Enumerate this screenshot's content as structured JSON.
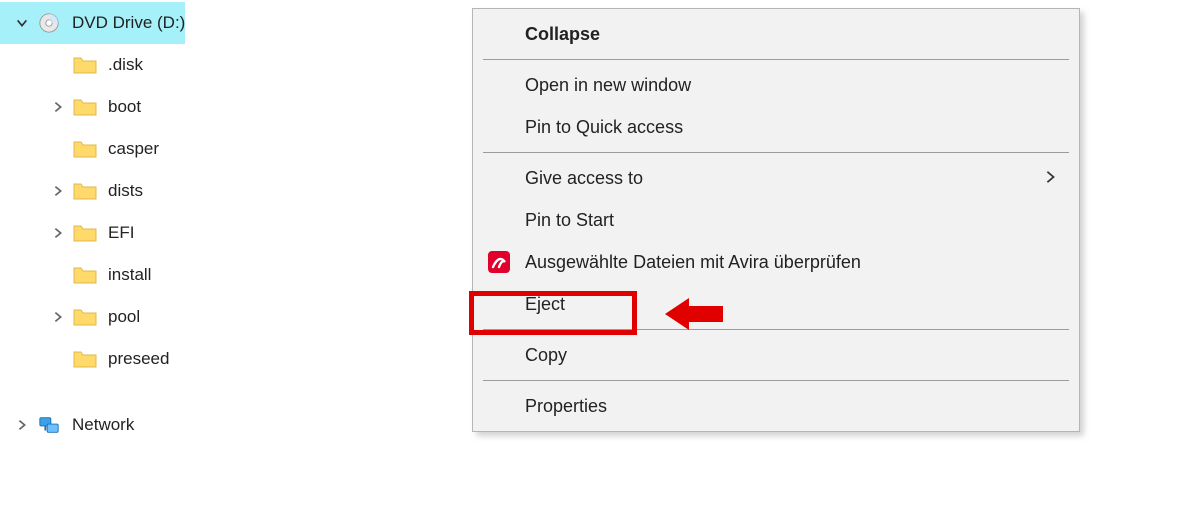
{
  "tree": {
    "drive": {
      "label": "DVD Drive (D:)",
      "expanded": true
    },
    "children": [
      {
        "label": ".disk",
        "expandable": false
      },
      {
        "label": "boot",
        "expandable": true
      },
      {
        "label": "casper",
        "expandable": false
      },
      {
        "label": "dists",
        "expandable": true
      },
      {
        "label": "EFI",
        "expandable": true
      },
      {
        "label": "install",
        "expandable": false
      },
      {
        "label": "pool",
        "expandable": true
      },
      {
        "label": "preseed",
        "expandable": false
      }
    ],
    "network": {
      "label": "Network",
      "expandable": true
    }
  },
  "menu": {
    "collapse": "Collapse",
    "open_new": "Open in new window",
    "pin_quick": "Pin to Quick access",
    "give_access": "Give access to",
    "pin_start": "Pin to Start",
    "avira": "Ausgewählte Dateien mit Avira überprüfen",
    "eject": "Eject",
    "copy": "Copy",
    "properties": "Properties"
  },
  "colors": {
    "selection_bg": "#a6f0f9",
    "annotation_red": "#e00000",
    "menu_bg": "#f2f2f2"
  }
}
